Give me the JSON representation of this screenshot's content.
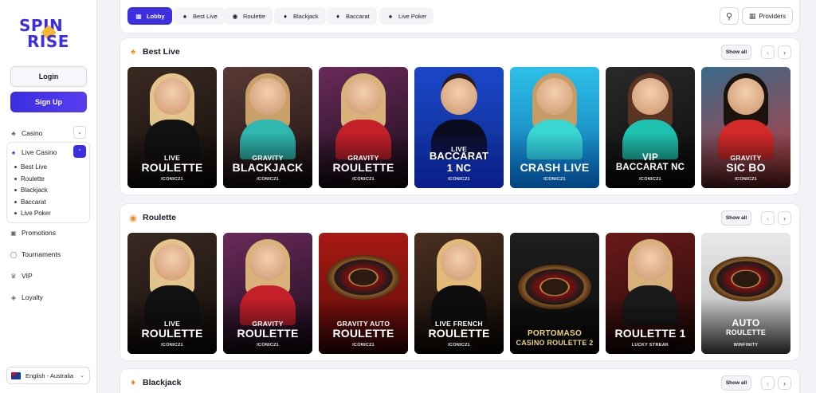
{
  "logo": {
    "line1": "SPIN",
    "line2": "RISE"
  },
  "auth": {
    "login_label": "Login",
    "signup_label": "Sign Up"
  },
  "nav": {
    "casino": "Casino",
    "live_casino": "Live Casino",
    "live_sub": [
      "Best Live",
      "Roulette",
      "Blackjack",
      "Baccarat",
      "Live Poker"
    ],
    "promotions": "Promotions",
    "tournaments": "Tournaments",
    "vip": "VIP",
    "loyalty": "Loyalty"
  },
  "language": "English - Australia",
  "tabs": [
    "Lobby",
    "Best Live",
    "Roulette",
    "Blackjack",
    "Baccarat",
    "Live Poker"
  ],
  "providers_label": "Providers",
  "show_all_label": "Show all",
  "sections": [
    {
      "title": "Best Live",
      "cards": [
        {
          "line1": "LIVE",
          "line2": "ROULETTE",
          "provider": "ICONIC21"
        },
        {
          "line1": "GRAVITY",
          "line2": "BLACKJACK",
          "provider": "ICONIC21"
        },
        {
          "line1": "GRAVITY",
          "line2": "ROULETTE",
          "provider": "ICONIC21"
        },
        {
          "line1": "LIVE",
          "line2": "BACCARAT 1 NC",
          "provider": "ICONIC21"
        },
        {
          "line1": "",
          "line2": "CRASH LIVE",
          "provider": "ICONIC21"
        },
        {
          "line1": "VIP",
          "line2": "BACCARAT NC",
          "provider": "ICONIC21"
        },
        {
          "line1": "GRAVITY",
          "line2": "SIC BO",
          "provider": "ICONIC21"
        }
      ]
    },
    {
      "title": "Roulette",
      "cards": [
        {
          "line1": "LIVE",
          "line2": "ROULETTE",
          "provider": "ICONIC21"
        },
        {
          "line1": "GRAVITY",
          "line2": "ROULETTE",
          "provider": "ICONIC21"
        },
        {
          "line1": "GRAVITY AUTO",
          "line2": "ROULETTE",
          "provider": "ICONIC21"
        },
        {
          "line1": "LIVE FRENCH",
          "line2": "ROULETTE",
          "provider": "ICONIC21"
        },
        {
          "line1": "PORTOMASO",
          "line2": "CASINO ROULETTE 2",
          "provider": ""
        },
        {
          "line1": "",
          "line2": "ROULETTE 1",
          "provider": "LUCKY STREAK"
        },
        {
          "line1": "AUTO",
          "line2": "ROULETTE",
          "provider": "WINFINITY"
        }
      ]
    },
    {
      "title": "Blackjack"
    }
  ],
  "colors": {
    "accent": "#3d2fe0",
    "section_icon": "#f08a24"
  }
}
